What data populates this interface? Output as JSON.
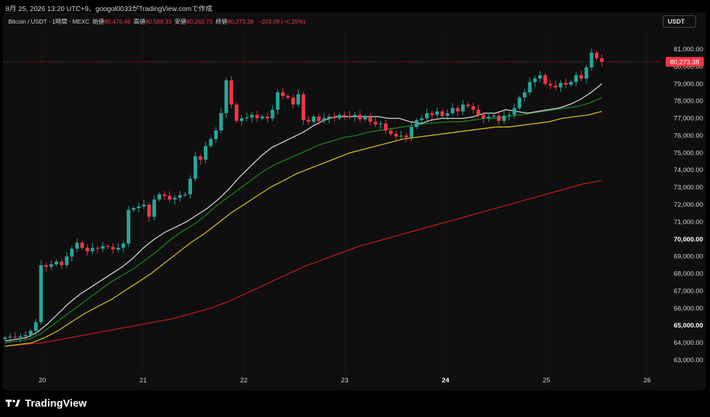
{
  "header": {
    "caption": "8月 25, 2026 13:20 UTC+9、googol0033がTradingView.comで作成"
  },
  "legend": {
    "symbol": "Bitcoin / USDT · 1時間 · MEXC",
    "open_label": "始値",
    "open_value": "80,476.48",
    "high_label": "高値",
    "high_value": "80,588.33",
    "low_label": "安値",
    "low_value": "80,262.73",
    "close_label": "終値",
    "close_value": "80,273.38",
    "change": "−203.09 (−0.25%)"
  },
  "currency_button": "USDT",
  "footer": {
    "brand": "TradingView"
  },
  "chart_data": {
    "type": "candlestick",
    "symbol": "Bitcoin / USDT",
    "interval": "1時間",
    "exchange": "MEXC",
    "y_range": [
      62500,
      81600
    ],
    "y_ticks": [
      "63,000.00",
      "64,000.00",
      "65,000.00",
      "66,000.00",
      "67,000.00",
      "68,000.00",
      "69,000.00",
      "70,000.00",
      "71,000.00",
      "72,000.00",
      "73,000.00",
      "74,000.00",
      "75,000.00",
      "76,000.00",
      "77,000.00",
      "78,000.00",
      "79,000.00",
      "80,000.00",
      "81,000.00"
    ],
    "y_tick_values": [
      63000,
      64000,
      65000,
      66000,
      67000,
      68000,
      69000,
      70000,
      71000,
      72000,
      73000,
      74000,
      75000,
      76000,
      77000,
      78000,
      79000,
      80000,
      81000
    ],
    "y_tick_bold": [
      65000,
      70000
    ],
    "x_ticks": [
      "20",
      "21",
      "22",
      "23",
      "24",
      "25",
      "26"
    ],
    "x_tick_bold": [
      "24"
    ],
    "x_range_days": [
      19.63,
      26.0
    ],
    "last_price": 80273.38,
    "last_price_label": "80,273.38",
    "colors": {
      "up": "#26a69a",
      "down": "#f23645",
      "ma_white": "#cfcfcf",
      "ma_green": "#1e7a1e",
      "ma_yellow": "#c8b820",
      "ma_red": "#b31b1b",
      "price_line": "#f23645"
    },
    "closes": [
      64300,
      64350,
      64320,
      64380,
      64450,
      64700,
      65200,
      68500,
      68400,
      68550,
      68700,
      68500,
      69000,
      69450,
      69800,
      69500,
      69300,
      69500,
      69450,
      69600,
      69550,
      69400,
      69500,
      69750,
      71700,
      71800,
      71900,
      72000,
      71300,
      72300,
      72600,
      72500,
      72300,
      72400,
      72550,
      72600,
      73500,
      74800,
      74600,
      75400,
      75800,
      76300,
      77300,
      79200,
      77800,
      76850,
      77000,
      77050,
      77200,
      77000,
      77100,
      77000,
      77500,
      78500,
      78300,
      78200,
      77800,
      78400,
      76900,
      76800,
      77100,
      76850,
      77000,
      77100,
      77000,
      77200,
      77150,
      77100,
      77200,
      76950,
      77100,
      76800,
      76650,
      76700,
      76300,
      76100,
      75950,
      76000,
      75900,
      76500,
      76900,
      77000,
      77300,
      77200,
      77400,
      77150,
      77300,
      77600,
      77400,
      77800,
      77700,
      77500,
      77200,
      77000,
      77100,
      77150,
      76850,
      77150,
      77200,
      77600,
      78200,
      78500,
      79100,
      79300,
      79500,
      79000,
      78900,
      78800,
      79050,
      78950,
      79100,
      79500,
      79300,
      79950,
      80800,
      80480,
      80273
    ],
    "ma_white": [
      64100,
      64200,
      64300,
      64600,
      65100,
      65700,
      66300,
      66800,
      67200,
      67600,
      68000,
      68400,
      68900,
      69500,
      70000,
      70400,
      70700,
      71000,
      71400,
      71800,
      72300,
      72900,
      73600,
      74200,
      74800,
      75300,
      75600,
      75900,
      76200,
      76600,
      76900,
      77100,
      77100,
      77100,
      77100,
      77100,
      77000,
      77000,
      76800,
      76700,
      76900,
      77000,
      77000,
      77000,
      77100,
      77300,
      77300,
      77500,
      77400,
      77300,
      77400,
      77500,
      77600,
      77800,
      78100,
      78500,
      79000
    ],
    "ma_green": [
      64000,
      64100,
      64200,
      64500,
      65000,
      65500,
      66000,
      66500,
      67000,
      67500,
      67900,
      68300,
      68800,
      69300,
      69900,
      70400,
      70800,
      71300,
      71900,
      72400,
      72900,
      73400,
      73900,
      74300,
      74600,
      74900,
      75200,
      75500,
      75700,
      75900,
      76000,
      76200,
      76300,
      76400,
      76500,
      76600,
      76700,
      76750,
      76800,
      76800,
      76900,
      77000,
      77000,
      77100,
      77200,
      77300,
      77400,
      77500,
      77600,
      77700,
      77900,
      78200
    ],
    "ma_yellow": [
      63800,
      63900,
      64000,
      64300,
      64700,
      65200,
      65700,
      66100,
      66500,
      67000,
      67500,
      68000,
      68600,
      69200,
      69800,
      70300,
      70900,
      71500,
      72000,
      72500,
      73000,
      73400,
      73800,
      74100,
      74400,
      74700,
      75000,
      75200,
      75400,
      75600,
      75800,
      75900,
      76000,
      76100,
      76200,
      76300,
      76400,
      76500,
      76500,
      76600,
      76700,
      76800,
      77000,
      77100,
      77200,
      77400
    ],
    "ma_red": [
      63800,
      63900,
      64000,
      64200,
      64400,
      64600,
      64800,
      65000,
      65200,
      65400,
      65700,
      66000,
      66400,
      66900,
      67400,
      67900,
      68400,
      68800,
      69200,
      69600,
      69900,
      70200,
      70500,
      70800,
      71100,
      71400,
      71700,
      72000,
      72300,
      72600,
      72900,
      73200,
      73400
    ]
  }
}
